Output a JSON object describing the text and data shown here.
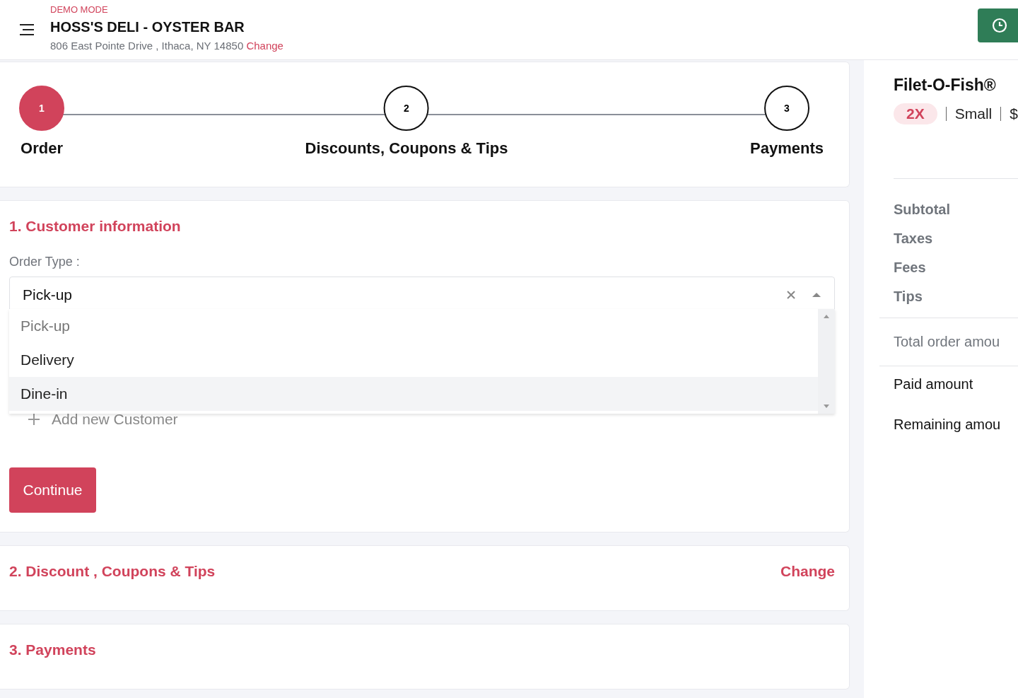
{
  "header": {
    "mode": "DEMO MODE",
    "store": "HOSS'S DELI - OYSTER BAR",
    "address": "806 East Pointe Drive , Ithaca, NY 14850",
    "change": "Change"
  },
  "steps": [
    {
      "number": "1",
      "label": "Order",
      "selected": true
    },
    {
      "number": "2",
      "label": "Discounts, Coupons & Tips",
      "selected": false
    },
    {
      "number": "3",
      "label": "Payments",
      "selected": false
    }
  ],
  "customer": {
    "title": "1. Customer information",
    "order_type_label": "Order Type :",
    "value": "Pick-up",
    "expanded": true,
    "options": [
      {
        "label": "Pick-up",
        "selected": true,
        "highlighted": false
      },
      {
        "label": "Delivery",
        "selected": false,
        "highlighted": false
      },
      {
        "label": "Dine-in",
        "selected": false,
        "highlighted": true
      }
    ],
    "add_customer": "Add new Customer",
    "continue": "Continue"
  },
  "discount": {
    "title": "2. Discount , Coupons & Tips",
    "change": "Change"
  },
  "payments": {
    "title": "3. Payments"
  },
  "summary": {
    "item": {
      "name": "Filet-O-Fish®",
      "quantity": "2X",
      "size": "Small",
      "price": "$"
    },
    "lines": [
      {
        "label": "Subtotal",
        "kind": "muted"
      },
      {
        "label": "Taxes",
        "kind": "muted"
      },
      {
        "label": "Fees",
        "kind": "muted"
      },
      {
        "label": "Tips",
        "kind": "muted"
      },
      {
        "label": "Total order amou",
        "kind": "total"
      },
      {
        "label": "Paid amount",
        "kind": "plain"
      },
      {
        "label": "Remaining amou",
        "kind": "plain"
      }
    ]
  }
}
